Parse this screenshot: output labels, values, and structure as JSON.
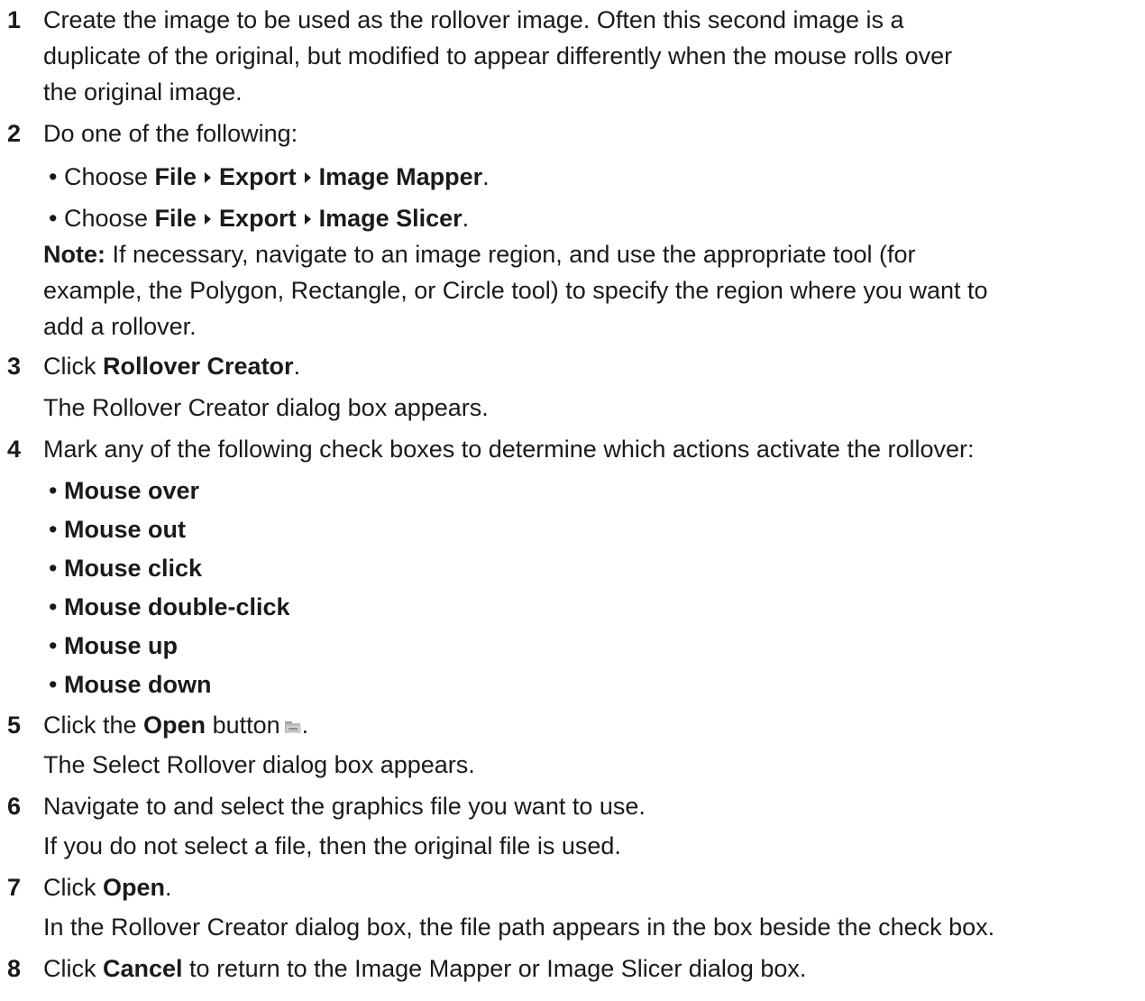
{
  "steps": [
    {
      "num": "1",
      "lines": [
        "Create the image to be used as the rollover image. Often this second image is a",
        "duplicate of the original, but modified to appear differently when the mouse rolls over",
        "the original image."
      ]
    },
    {
      "num": "2",
      "text": "Do one of the following:",
      "bullets": [
        {
          "prefix": "• Choose ",
          "items": [
            "File",
            "Export",
            "Image Mapper"
          ],
          "suffix": "."
        },
        {
          "prefix": "• Choose ",
          "items": [
            "File",
            "Export",
            "Image Slicer"
          ],
          "suffix": "."
        }
      ],
      "note_label": "Note:",
      "note_lines": [
        " If necessary, navigate to an image region, and use the appropriate tool (for",
        "example, the Polygon, Rectangle, or Circle tool) to specify the region where you want to",
        "add a rollover."
      ]
    },
    {
      "num": "3",
      "prefix": "Click ",
      "bold": "Rollover Creator",
      "suffix": ".",
      "result": "The Rollover Creator dialog box appears."
    },
    {
      "num": "4",
      "text": "Mark any of the following check boxes to determine which actions activate the rollover:",
      "options": [
        "Mouse over",
        "Mouse out",
        "Mouse click",
        "Mouse double-click",
        "Mouse up",
        "Mouse down"
      ]
    },
    {
      "num": "5",
      "prefix": "Click the ",
      "bold": "Open",
      "suffix": " button",
      "icon": "open-folder-icon",
      "after_icon": ".",
      "result": "The Select Rollover dialog box appears."
    },
    {
      "num": "6",
      "text": "Navigate to and select the graphics file you want to use.",
      "result": "If you do not select a file, then the original file is used."
    },
    {
      "num": "7",
      "prefix": "Click ",
      "bold": "Open",
      "suffix": ".",
      "result": "In the Rollover Creator dialog box, the file path appears in the box beside the check box."
    },
    {
      "num": "8",
      "prefix": "Click ",
      "bold": "Cancel",
      "suffix": " to return to the Image Mapper or Image Slicer dialog box."
    }
  ],
  "bullet_char": "• "
}
